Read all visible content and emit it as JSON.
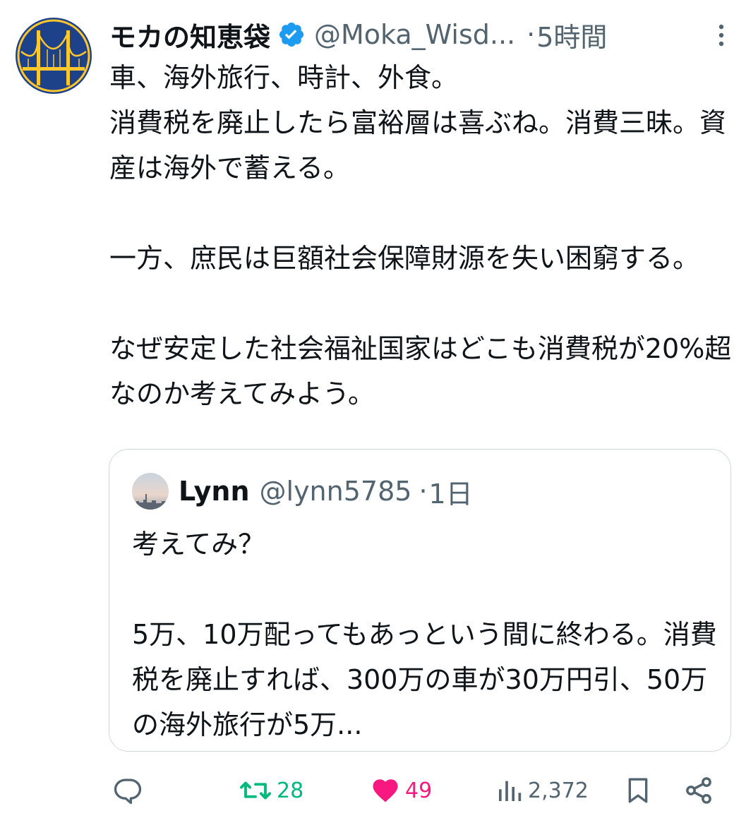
{
  "tweet": {
    "author_name": "モカの知恵袋",
    "handle": "@Moka_Wisd...",
    "separator": "·",
    "time": "5時間",
    "body": "車、海外旅行、時計、外食。\n消費税を廃止したら富裕層は喜ぶね。消費三昧。資産は海外で蓄える。\n\n一方、庶民は巨額社会保障財源を失い困窮する。\n\nなぜ安定した社会福祉国家はどこも消費税が20%超なのか考えてみよう。"
  },
  "quote": {
    "author_name": "Lynn",
    "handle": "@lynn5785",
    "separator": "·",
    "time": "1日",
    "body": "考えてみ？\n\n5万、10万配ってもあっという間に終わる。消費税を廃止すれば、300万の車が30万円引、50万の海外旅行が5万..."
  },
  "actions": {
    "retweets": "28",
    "likes": "49",
    "views": "2,372"
  },
  "colors": {
    "accent": "#1d9bf0",
    "retweet": "#00ba7c",
    "like": "#f91880",
    "muted": "#536471",
    "avatar_bg": "#1d428a",
    "avatar_gold": "#ffc72c"
  }
}
